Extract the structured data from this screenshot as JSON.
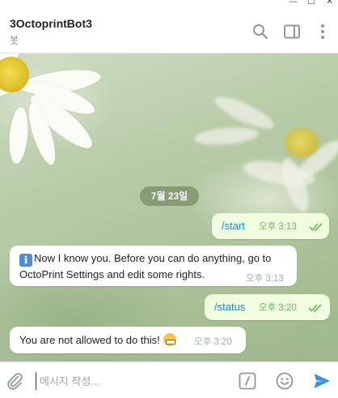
{
  "window": {
    "minimize_glyph": "—",
    "maximize_glyph": "☐",
    "close_glyph": "✕"
  },
  "header": {
    "title": "3OctoprintBot3",
    "subtitle": "봇",
    "icons": [
      "search-icon",
      "sidebar-toggle-icon",
      "more-vertical-icon"
    ]
  },
  "chat": {
    "date_label": "7월 23일",
    "messages": [
      {
        "direction": "out",
        "text": "/start",
        "time": "오후 3:13",
        "status": "read"
      },
      {
        "direction": "in",
        "icon": "info-icon",
        "icon_glyph": "i",
        "text": "Now I know you. Before you can do anything, go to OctoPrint Settings and edit some rights.",
        "time": "오후 3:13"
      },
      {
        "direction": "out",
        "text": "/status",
        "time": "오후 3:20",
        "status": "read"
      },
      {
        "direction": "in",
        "text": "You are not allowed to do this!",
        "emoji": "grimacing-face-emoji",
        "time": "오후 3:20"
      }
    ]
  },
  "composer": {
    "placeholder": "메시지 작성...",
    "value": "",
    "icons": [
      "attach-icon",
      "commands-icon",
      "emoji-icon",
      "send-icon"
    ],
    "commands_glyph": "/"
  },
  "colors": {
    "accent": "#168acd",
    "outgoing_bubble": "#effdde",
    "incoming_bubble": "#ffffff",
    "outgoing_time": "#6cb466",
    "send": "#3a95d6"
  }
}
